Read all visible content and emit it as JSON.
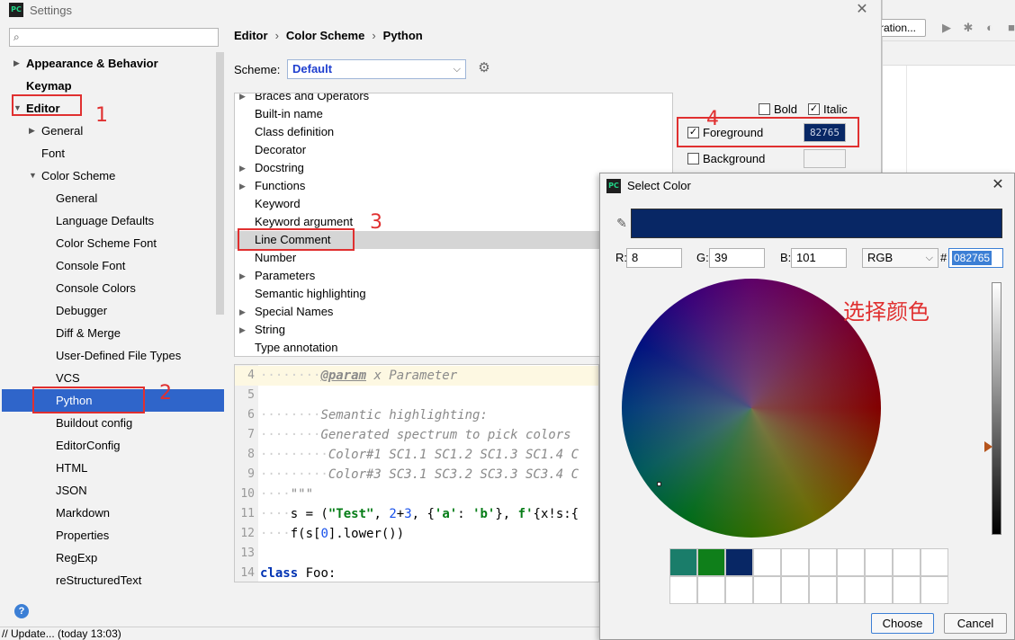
{
  "background_ide": {
    "configuration_label": "ration...",
    "icons": [
      "run-icon",
      "debug-icon",
      "coverage-icon",
      "stop-icon"
    ]
  },
  "settings": {
    "title": "Settings",
    "app_logo": "PC",
    "search": {
      "placeholder": "",
      "value": ""
    },
    "tree": [
      {
        "label": "Appearance & Behavior",
        "bold": true,
        "expanded": false
      },
      {
        "label": "Keymap",
        "bold": true
      },
      {
        "label": "Editor",
        "bold": true,
        "expanded": true
      },
      {
        "label": "General",
        "expanded": false
      },
      {
        "label": "Font"
      },
      {
        "label": "Color Scheme",
        "expanded": true
      },
      {
        "label": "General"
      },
      {
        "label": "Language Defaults"
      },
      {
        "label": "Color Scheme Font"
      },
      {
        "label": "Console Font"
      },
      {
        "label": "Console Colors"
      },
      {
        "label": "Debugger"
      },
      {
        "label": "Diff & Merge"
      },
      {
        "label": "User-Defined File Types"
      },
      {
        "label": "VCS"
      },
      {
        "label": "Python",
        "selected": true
      },
      {
        "label": "Buildout config"
      },
      {
        "label": "EditorConfig"
      },
      {
        "label": "HTML"
      },
      {
        "label": "JSON"
      },
      {
        "label": "Markdown"
      },
      {
        "label": "Properties"
      },
      {
        "label": "RegExp"
      },
      {
        "label": "reStructuredText"
      }
    ],
    "breadcrumb": [
      "Editor",
      "Color Scheme",
      "Python"
    ],
    "breadcrumb_sep": "›",
    "scheme": {
      "label": "Scheme:",
      "value": "Default"
    },
    "attributes": [
      {
        "label": "Braces and Operators",
        "expandable": true
      },
      {
        "label": "Built-in name"
      },
      {
        "label": "Class definition"
      },
      {
        "label": "Decorator"
      },
      {
        "label": "Docstring",
        "expandable": true
      },
      {
        "label": "Functions",
        "expandable": true
      },
      {
        "label": "Keyword"
      },
      {
        "label": "Keyword argument"
      },
      {
        "label": "Line Comment",
        "selected": true
      },
      {
        "label": "Number"
      },
      {
        "label": "Parameters",
        "expandable": true
      },
      {
        "label": "Semantic highlighting"
      },
      {
        "label": "Special Names",
        "expandable": true
      },
      {
        "label": "String",
        "expandable": true
      },
      {
        "label": "Type annotation"
      }
    ],
    "options": {
      "bold": {
        "label": "Bold",
        "checked": false
      },
      "italic": {
        "label": "Italic",
        "checked": true
      },
      "foreground": {
        "label": "Foreground",
        "checked": true,
        "value": "82765",
        "color": "#082765"
      },
      "background": {
        "label": "Background",
        "checked": false
      }
    },
    "preview_lines": [
      {
        "num": "4",
        "dots": "········",
        "parts": [
          {
            "t": "@param",
            "c": "tag"
          },
          {
            "t": " x Parameter",
            "c": "doc"
          }
        ],
        "highlight": true
      },
      {
        "num": "5",
        "dots": "",
        "parts": []
      },
      {
        "num": "6",
        "dots": "········",
        "parts": [
          {
            "t": "Semantic highlighting:",
            "c": "doc"
          }
        ]
      },
      {
        "num": "7",
        "dots": "········",
        "parts": [
          {
            "t": "Generated spectrum to pick colors",
            "c": "doc"
          }
        ]
      },
      {
        "num": "8",
        "dots": "·········",
        "parts": [
          {
            "t": "Color#1 SC1.1 SC1.2 SC1.3 SC1.4 C",
            "c": "doc"
          }
        ]
      },
      {
        "num": "9",
        "dots": "·········",
        "parts": [
          {
            "t": "Color#3 SC3.1 SC3.2 SC3.3 SC3.4 C",
            "c": "doc"
          }
        ]
      },
      {
        "num": "10",
        "dots": "····",
        "parts": [
          {
            "t": "\"\"\"",
            "c": "doc"
          }
        ]
      },
      {
        "num": "11",
        "dots": "····",
        "parts": [
          {
            "t": "s = (",
            "c": "plain"
          },
          {
            "t": "\"Test\"",
            "c": "str"
          },
          {
            "t": ", ",
            "c": "plain"
          },
          {
            "t": "2",
            "c": "num"
          },
          {
            "t": "+",
            "c": "plain"
          },
          {
            "t": "3",
            "c": "num"
          },
          {
            "t": ", {",
            "c": "plain"
          },
          {
            "t": "'a'",
            "c": "str"
          },
          {
            "t": ": ",
            "c": "plain"
          },
          {
            "t": "'b'",
            "c": "str"
          },
          {
            "t": "}, ",
            "c": "plain"
          },
          {
            "t": "f'",
            "c": "str"
          },
          {
            "t": "{x!s:{",
            "c": "plain"
          }
        ]
      },
      {
        "num": "12",
        "dots": "····",
        "parts": [
          {
            "t": "f(s[",
            "c": "plain"
          },
          {
            "t": "0",
            "c": "num"
          },
          {
            "t": "].lower())",
            "c": "plain"
          }
        ]
      },
      {
        "num": "13",
        "dots": "",
        "parts": []
      },
      {
        "num": "14",
        "dots": "",
        "parts": [
          {
            "t": "class",
            "c": "kw"
          },
          {
            "t": " Foo:",
            "c": "plain"
          }
        ]
      }
    ],
    "status_text": "// Update... (today 13:03)",
    "help_label": "?"
  },
  "annotations": [
    "1",
    "2",
    "3",
    "4"
  ],
  "select_color": {
    "title": "Select Color",
    "app_logo": "PC",
    "current_color": "#082765",
    "r_label": "R:",
    "r": "8",
    "g_label": "G:",
    "g": "39",
    "b_label": "B:",
    "b": "101",
    "mode": "RGB",
    "hash_label": "#",
    "hex": "082765",
    "note": "选择颜色",
    "brightness": 0.65,
    "recent_colors": [
      "#1a7d6a",
      "#0f7f1a",
      "#082765"
    ],
    "recent_slots": 20,
    "choose_label": "Choose",
    "cancel_label": "Cancel"
  }
}
